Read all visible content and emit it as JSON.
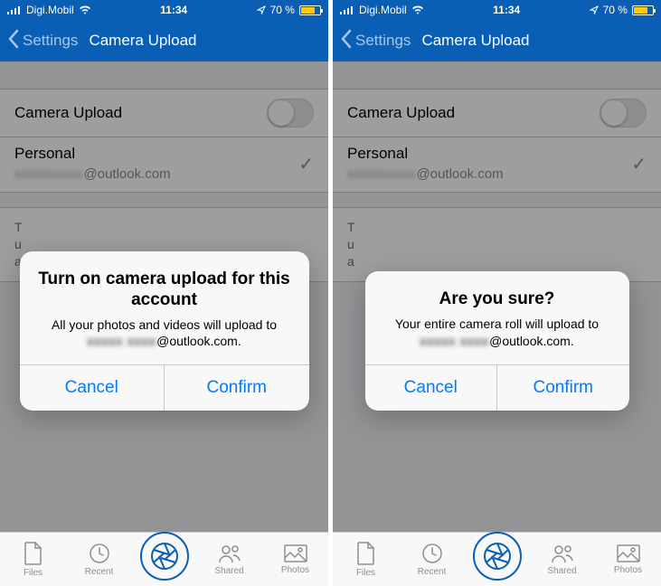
{
  "status": {
    "carrier": "Digi.Mobil",
    "time": "11:34",
    "battery_pct": "70 %"
  },
  "nav": {
    "back": "Settings",
    "title": "Camera Upload"
  },
  "rows": {
    "camera_upload": "Camera Upload",
    "personal": "Personal",
    "email_suffix": "@outlook.com",
    "desc_partial": "T\nu\na"
  },
  "tabs": {
    "files": "Files",
    "recent": "Recent",
    "shared": "Shared",
    "photos": "Photos"
  },
  "alert_left": {
    "title": "Turn on camera upload for this account",
    "msg_pre": "All your photos and videos will upload to ",
    "msg_post": "@outlook.com.",
    "cancel": "Cancel",
    "confirm": "Confirm"
  },
  "alert_right": {
    "title": "Are you sure?",
    "msg_pre": "Your entire camera roll will upload to ",
    "msg_post": "@outlook.com.",
    "cancel": "Cancel",
    "confirm": "Confirm"
  }
}
